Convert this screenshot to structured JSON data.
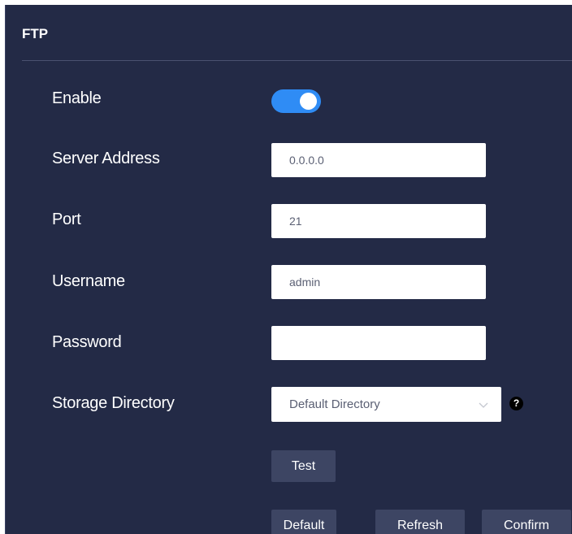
{
  "panel": {
    "title": "FTP"
  },
  "form": {
    "enable": {
      "label": "Enable",
      "value": "on"
    },
    "server_address": {
      "label": "Server Address",
      "value": "0.0.0.0"
    },
    "port": {
      "label": "Port",
      "value": "21"
    },
    "username": {
      "label": "Username",
      "value": "admin"
    },
    "password": {
      "label": "Password",
      "value": ""
    },
    "storage_directory": {
      "label": "Storage Directory",
      "value": "Default Directory",
      "help": "?"
    }
  },
  "buttons": {
    "test": "Test",
    "default": "Default",
    "refresh": "Refresh",
    "confirm": "Confirm"
  },
  "colors": {
    "panel_background": "#232a46",
    "toggle_on": "#2f8cf5",
    "button_background": "#3d4563"
  },
  "icons": {
    "dropdown": "chevron-down-icon",
    "help": "help-icon"
  }
}
